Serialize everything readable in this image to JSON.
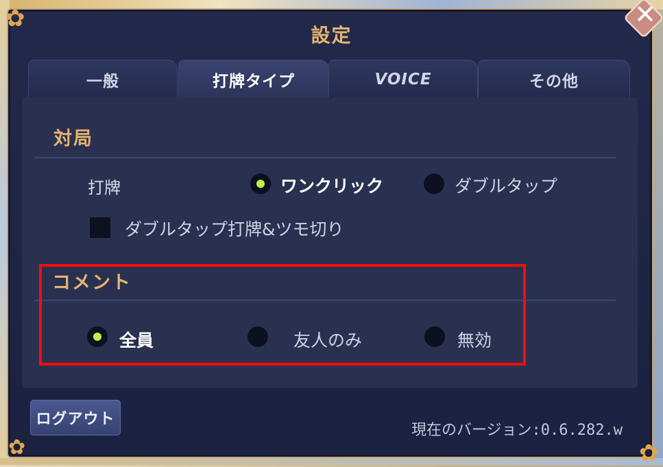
{
  "window": {
    "title": "設定",
    "close_icon": "close-icon"
  },
  "tabs": [
    {
      "label": "一般",
      "active": false
    },
    {
      "label": "打牌タイプ",
      "active": true
    },
    {
      "label": "VOICE",
      "active": false
    },
    {
      "label": "その他",
      "active": false
    }
  ],
  "match_section": {
    "title": "対局",
    "discard_label": "打牌",
    "discard_options": [
      {
        "label": "ワンクリック",
        "selected": true
      },
      {
        "label": "ダブルタップ",
        "selected": false
      }
    ],
    "double_tap_checkbox": {
      "label": "ダブルタップ打牌&ツモ切り",
      "checked": false
    }
  },
  "comment_section": {
    "title": "コメント",
    "options": [
      {
        "label": "全員",
        "selected": true
      },
      {
        "label": "友人のみ",
        "selected": false
      },
      {
        "label": "無効",
        "selected": false
      }
    ]
  },
  "footer": {
    "logout_label": "ログアウト",
    "version_text": "現在のバージョン:0.6.282.w"
  },
  "colors": {
    "accent_gold": "#e3b46f",
    "radio_selected": "#bff04a",
    "highlight_red": "#ff0a0a",
    "panel_bg": "#23294a"
  }
}
